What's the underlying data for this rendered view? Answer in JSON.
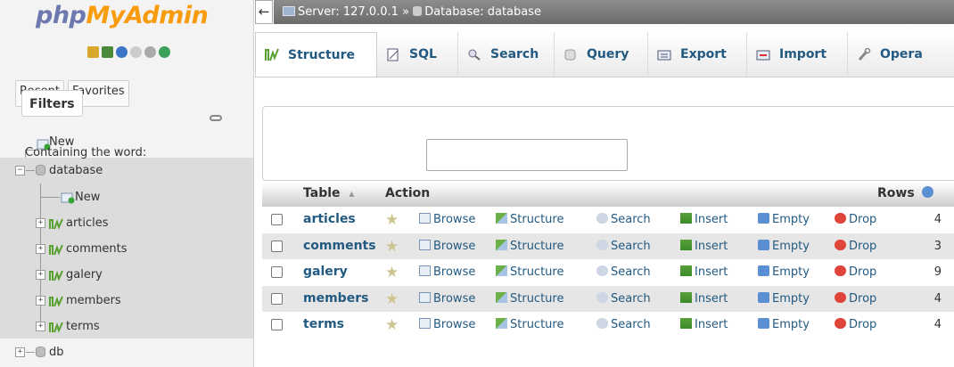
{
  "nav": {
    "logo_php": "php",
    "logo_rest": "MyAdmin",
    "tabs": [
      "Recent",
      "Favorites"
    ],
    "tree": {
      "new": "New",
      "database": "database",
      "db_new": "New",
      "tables": [
        "articles",
        "comments",
        "galery",
        "members",
        "terms"
      ],
      "other_db": "db"
    }
  },
  "topbar": {
    "back": "←",
    "server": "Server: 127.0.0.1",
    "sep": "»",
    "database": "Database: database"
  },
  "tabs": [
    {
      "label": "Structure",
      "icon": "structure-icon"
    },
    {
      "label": "SQL",
      "icon": "sql-icon"
    },
    {
      "label": "Search",
      "icon": "search-icon"
    },
    {
      "label": "Query",
      "icon": "query-icon"
    },
    {
      "label": "Export",
      "icon": "export-icon"
    },
    {
      "label": "Import",
      "icon": "import-icon"
    },
    {
      "label": "Opera",
      "icon": "wrench-icon"
    }
  ],
  "filters": {
    "legend": "Filters",
    "label": "Containing the word:",
    "value": ""
  },
  "table": {
    "headers": {
      "table": "Table",
      "sort": "▲",
      "action": "Action",
      "rows": "Rows"
    },
    "actions": [
      "Browse",
      "Structure",
      "Search",
      "Insert",
      "Empty",
      "Drop"
    ],
    "rows": [
      {
        "name": "articles",
        "rows": "4"
      },
      {
        "name": "comments",
        "rows": "3"
      },
      {
        "name": "galery",
        "rows": "9"
      },
      {
        "name": "members",
        "rows": "4"
      },
      {
        "name": "terms",
        "rows": "4"
      }
    ]
  },
  "colors": {
    "link": "#235a81",
    "logo_blue": "#6c78af",
    "logo_orange": "#f89c0e",
    "drop_red": "#e0433a"
  }
}
